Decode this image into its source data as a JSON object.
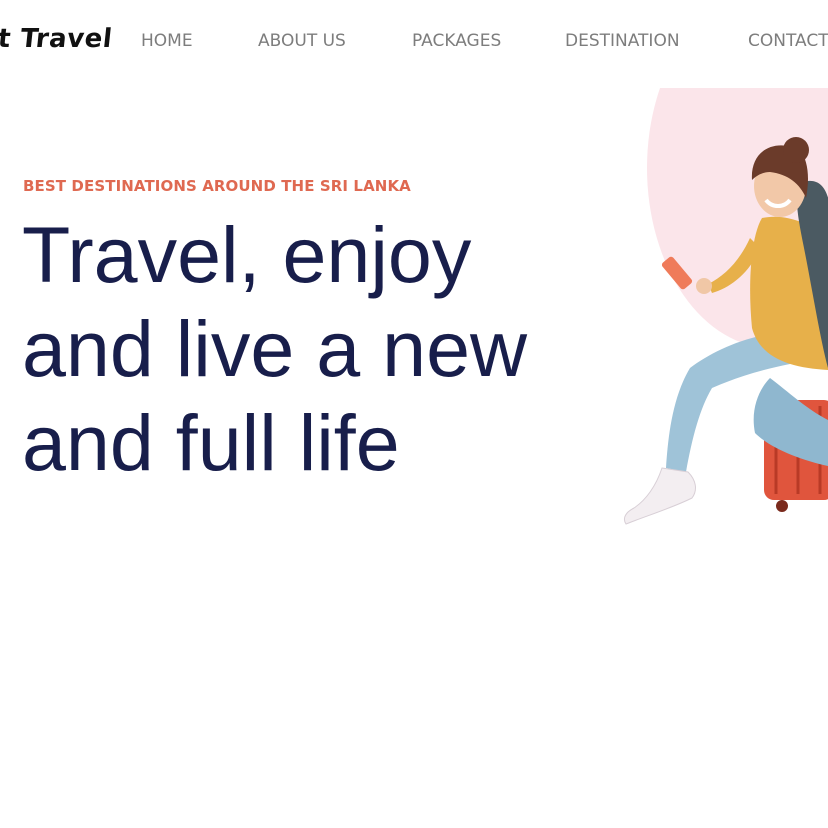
{
  "brand": {
    "name": "t Travel"
  },
  "nav": {
    "items": [
      {
        "label": "HOME"
      },
      {
        "label": "ABOUT US"
      },
      {
        "label": "PACKAGES"
      },
      {
        "label": "DESTINATION"
      },
      {
        "label": "CONTACT"
      }
    ]
  },
  "hero": {
    "eyebrow": "BEST DESTINATIONS AROUND THE SRI LANKA",
    "headline_lines": [
      "Travel, enjoy",
      "and live a new",
      "and full life"
    ]
  },
  "colors": {
    "accent": "#df6951",
    "headline": "#181e4b",
    "nav_text": "#7d7d7d",
    "blob": "#fbe5ea"
  }
}
